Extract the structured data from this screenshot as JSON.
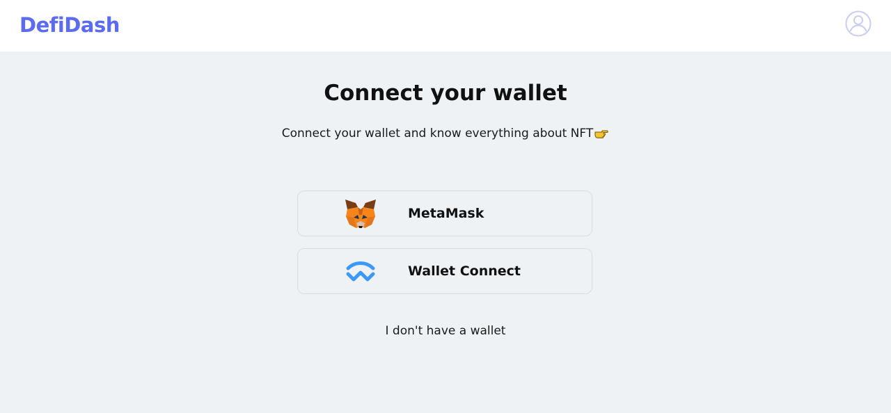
{
  "header": {
    "logo_text": "DefiDash",
    "profile_icon": "user-circle-icon"
  },
  "main": {
    "title": "Connect your wallet",
    "subtitle": "Connect your wallet and know everything about NFT",
    "subtitle_icon": "pointing-hand-icon",
    "wallets": [
      {
        "label": "MetaMask",
        "icon": "metamask-fox-icon"
      },
      {
        "label": "Wallet Connect",
        "icon": "walletconnect-icon"
      }
    ],
    "no_wallet_link": "I don't have a wallet"
  },
  "colors": {
    "brand": "#5b6cf0",
    "background": "#eff2f5",
    "header_bg": "#ffffff",
    "walletconnect_blue": "#3b99fc",
    "metamask_orange": "#f6851b"
  }
}
